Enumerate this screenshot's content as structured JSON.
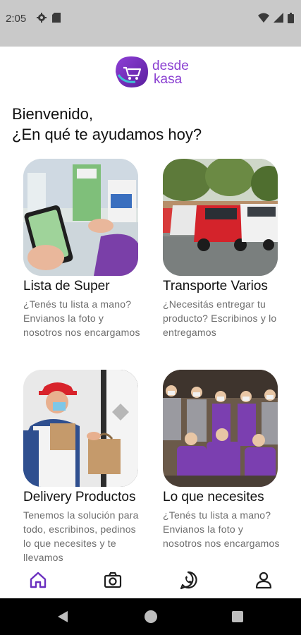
{
  "status_bar": {
    "time": "2:05",
    "icons_left": [
      "gear-icon",
      "sd-card-icon"
    ],
    "icons_right": [
      "wifi-icon",
      "signal-icon",
      "battery-icon"
    ]
  },
  "brand": {
    "logo_line1": "desde",
    "logo_line2": "kasa",
    "logo_color": "#7b2fc4"
  },
  "greeting": {
    "line1": "Bienvenido,",
    "line2": "¿En qué te ayudamos hoy?"
  },
  "cards": [
    {
      "title": "Lista de Super",
      "desc": "¿Tenés tu lista a mano? Envianos la foto y nosotros nos encargamos"
    },
    {
      "title": "Transporte Varios",
      "desc": "¿Necesitás entregar tu producto? Escribinos y lo entregamos"
    },
    {
      "title": "Delivery Productos",
      "desc": "Tenemos la solución para todo, escribinos, pedinos lo que necesites y te llevamos"
    },
    {
      "title": "Lo que necesites",
      "desc": "¿Tenés tu lista a mano? Envianos la foto y nosotros nos encargamos"
    }
  ],
  "bottom_nav": {
    "items": [
      "home-icon",
      "camera-icon",
      "whatsapp-icon",
      "profile-icon"
    ],
    "active": "home-icon",
    "accent": "#6a2fbf"
  },
  "system_nav": [
    "back-icon",
    "home-circle-icon",
    "recents-icon"
  ]
}
